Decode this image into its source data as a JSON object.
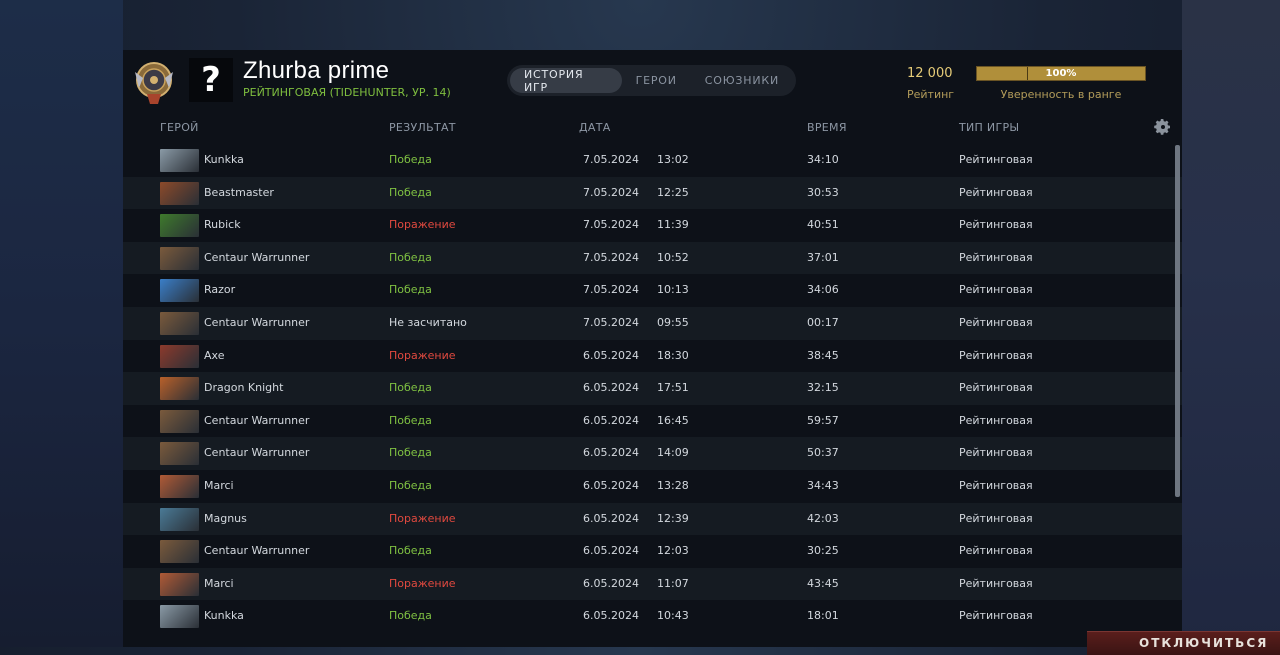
{
  "player": {
    "name": "Zhurba prime",
    "subtitle": "РЕЙТИНГОВАЯ (TIDEHUNTER, УР. 14)",
    "avatar_glyph": "?",
    "rank_icon": "rank-medal-icon"
  },
  "tabs": [
    {
      "label": "ИСТОРИЯ ИГР",
      "active": true
    },
    {
      "label": "ГЕРОИ",
      "active": false
    },
    {
      "label": "СОЮЗНИКИ",
      "active": false
    }
  ],
  "rating": {
    "value": "12 000",
    "label": "Рейтинг"
  },
  "confidence": {
    "value": "100%",
    "label": "Уверенность в ранге",
    "fraction": 1.0
  },
  "columns": {
    "hero": "ГЕРОЙ",
    "result": "РЕЗУЛЬТАТ",
    "date": "ДАТА",
    "duration": "ВРЕМЯ",
    "game_type": "ТИП ИГРЫ"
  },
  "settings_icon": "gear-icon",
  "matches": [
    {
      "hero": "Kunkka",
      "result": "Победа",
      "outcome": "win",
      "date": "7.05.2024",
      "time": "13:02",
      "duration": "34:10",
      "type": "Рейтинговая",
      "thumb_color": "#8a9aa6"
    },
    {
      "hero": "Beastmaster",
      "result": "Победа",
      "outcome": "win",
      "date": "7.05.2024",
      "time": "12:25",
      "duration": "30:53",
      "type": "Рейтинговая",
      "thumb_color": "#8c4a2a"
    },
    {
      "hero": "Rubick",
      "result": "Поражение",
      "outcome": "loss",
      "date": "7.05.2024",
      "time": "11:39",
      "duration": "40:51",
      "type": "Рейтинговая",
      "thumb_color": "#3e7a2c"
    },
    {
      "hero": "Centaur Warrunner",
      "result": "Победа",
      "outcome": "win",
      "date": "7.05.2024",
      "time": "10:52",
      "duration": "37:01",
      "type": "Рейтинговая",
      "thumb_color": "#7a5a3c"
    },
    {
      "hero": "Razor",
      "result": "Победа",
      "outcome": "win",
      "date": "7.05.2024",
      "time": "10:13",
      "duration": "34:06",
      "type": "Рейтинговая",
      "thumb_color": "#3a7ec8"
    },
    {
      "hero": "Centaur Warrunner",
      "result": "Не засчитано",
      "outcome": "neutral",
      "date": "7.05.2024",
      "time": "09:55",
      "duration": "00:17",
      "type": "Рейтинговая",
      "thumb_color": "#7a5a3c"
    },
    {
      "hero": "Axe",
      "result": "Поражение",
      "outcome": "loss",
      "date": "6.05.2024",
      "time": "18:30",
      "duration": "38:45",
      "type": "Рейтинговая",
      "thumb_color": "#8c3a2c"
    },
    {
      "hero": "Dragon Knight",
      "result": "Победа",
      "outcome": "win",
      "date": "6.05.2024",
      "time": "17:51",
      "duration": "32:15",
      "type": "Рейтинговая",
      "thumb_color": "#b8602a"
    },
    {
      "hero": "Centaur Warrunner",
      "result": "Победа",
      "outcome": "win",
      "date": "6.05.2024",
      "time": "16:45",
      "duration": "59:57",
      "type": "Рейтинговая",
      "thumb_color": "#7a5a3c"
    },
    {
      "hero": "Centaur Warrunner",
      "result": "Победа",
      "outcome": "win",
      "date": "6.05.2024",
      "time": "14:09",
      "duration": "50:37",
      "type": "Рейтинговая",
      "thumb_color": "#7a5a3c"
    },
    {
      "hero": "Marci",
      "result": "Победа",
      "outcome": "win",
      "date": "6.05.2024",
      "time": "13:28",
      "duration": "34:43",
      "type": "Рейтинговая",
      "thumb_color": "#b05a36"
    },
    {
      "hero": "Magnus",
      "result": "Поражение",
      "outcome": "loss",
      "date": "6.05.2024",
      "time": "12:39",
      "duration": "42:03",
      "type": "Рейтинговая",
      "thumb_color": "#4a7a96"
    },
    {
      "hero": "Centaur Warrunner",
      "result": "Победа",
      "outcome": "win",
      "date": "6.05.2024",
      "time": "12:03",
      "duration": "30:25",
      "type": "Рейтинговая",
      "thumb_color": "#7a5a3c"
    },
    {
      "hero": "Marci",
      "result": "Поражение",
      "outcome": "loss",
      "date": "6.05.2024",
      "time": "11:07",
      "duration": "43:45",
      "type": "Рейтинговая",
      "thumb_color": "#b05a36"
    },
    {
      "hero": "Kunkka",
      "result": "Победа",
      "outcome": "win",
      "date": "6.05.2024",
      "time": "10:43",
      "duration": "18:01",
      "type": "Рейтинговая",
      "thumb_color": "#8a9aa6"
    }
  ],
  "disconnect_label": "ОТКЛЮЧИТЬСЯ"
}
